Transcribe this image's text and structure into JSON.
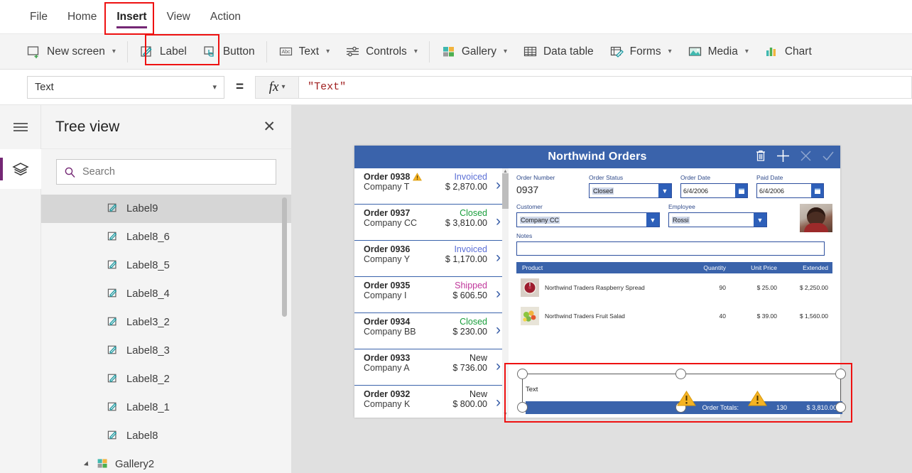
{
  "menu": {
    "tabs": [
      {
        "label": "File",
        "active": false
      },
      {
        "label": "Home",
        "active": false
      },
      {
        "label": "Insert",
        "active": true
      },
      {
        "label": "View",
        "active": false
      },
      {
        "label": "Action",
        "active": false
      }
    ]
  },
  "ribbon": {
    "items": [
      {
        "label": "New screen",
        "icon": "new-screen-icon",
        "caret": true
      },
      {
        "label": "Label",
        "icon": "label-icon",
        "caret": false,
        "highlighted": true
      },
      {
        "label": "Button",
        "icon": "button-icon",
        "caret": false
      },
      {
        "label": "Text",
        "icon": "text-icon",
        "caret": true
      },
      {
        "label": "Controls",
        "icon": "controls-icon",
        "caret": true
      },
      {
        "label": "Gallery",
        "icon": "gallery-icon",
        "caret": true
      },
      {
        "label": "Data table",
        "icon": "data-table-icon",
        "caret": false
      },
      {
        "label": "Forms",
        "icon": "forms-icon",
        "caret": true
      },
      {
        "label": "Media",
        "icon": "media-icon",
        "caret": true
      },
      {
        "label": "Chart",
        "icon": "chart-icon",
        "caret": true
      }
    ]
  },
  "formula_bar": {
    "property": "Text",
    "equals": "=",
    "fx_label": "fx",
    "value": "\"Text\""
  },
  "tree_view": {
    "title": "Tree view",
    "close_label": "✕",
    "search_placeholder": "Search",
    "items": [
      {
        "label": "Label9",
        "selected": true,
        "type": "label"
      },
      {
        "label": "Label8_6",
        "selected": false,
        "type": "label"
      },
      {
        "label": "Label8_5",
        "selected": false,
        "type": "label"
      },
      {
        "label": "Label8_4",
        "selected": false,
        "type": "label"
      },
      {
        "label": "Label3_2",
        "selected": false,
        "type": "label"
      },
      {
        "label": "Label8_3",
        "selected": false,
        "type": "label"
      },
      {
        "label": "Label8_2",
        "selected": false,
        "type": "label"
      },
      {
        "label": "Label8_1",
        "selected": false,
        "type": "label"
      },
      {
        "label": "Label8",
        "selected": false,
        "type": "label"
      },
      {
        "label": "Gallery2",
        "selected": false,
        "type": "gallery"
      }
    ]
  },
  "app": {
    "title": "Northwind Orders",
    "header_icons": [
      "trash-icon",
      "plus-icon",
      "close-icon",
      "check-icon"
    ],
    "orders": [
      {
        "id": "Order 0938",
        "company": "Company T",
        "status": "Invoiced",
        "status_color": "#5b6fd6",
        "amount": "$ 2,870.00",
        "warning": true
      },
      {
        "id": "Order 0937",
        "company": "Company CC",
        "status": "Closed",
        "status_color": "#1a9e3c",
        "amount": "$ 3,810.00",
        "warning": false
      },
      {
        "id": "Order 0936",
        "company": "Company Y",
        "status": "Invoiced",
        "status_color": "#5b6fd6",
        "amount": "$ 1,170.00",
        "warning": false
      },
      {
        "id": "Order 0935",
        "company": "Company I",
        "status": "Shipped",
        "status_color": "#c0379b",
        "amount": "$ 606.50",
        "warning": false
      },
      {
        "id": "Order 0934",
        "company": "Company BB",
        "status": "Closed",
        "status_color": "#1a9e3c",
        "amount": "$ 230.00",
        "warning": false
      },
      {
        "id": "Order 0933",
        "company": "Company A",
        "status": "New",
        "status_color": "#2b2b2b",
        "amount": "$ 736.00",
        "warning": false
      },
      {
        "id": "Order 0932",
        "company": "Company K",
        "status": "New",
        "status_color": "#2b2b2b",
        "amount": "$ 800.00",
        "warning": false
      }
    ],
    "detail": {
      "order_number_label": "Order Number",
      "order_number_value": "0937",
      "order_status_label": "Order Status",
      "order_status_value": "Closed",
      "order_date_label": "Order Date",
      "order_date_value": "6/4/2006",
      "paid_date_label": "Paid Date",
      "paid_date_value": "6/4/2006",
      "customer_label": "Customer",
      "customer_value": "Company CC",
      "employee_label": "Employee",
      "employee_value": "Rossi",
      "notes_label": "Notes",
      "notes_value": ""
    },
    "product_table": {
      "columns": [
        "Product",
        "Quantity",
        "Unit Price",
        "Extended"
      ],
      "rows": [
        {
          "product": "Northwind Traders Raspberry Spread",
          "quantity": "90",
          "unit_price": "$ 25.00",
          "extended": "$ 2,250.00"
        },
        {
          "product": "Northwind Traders Fruit Salad",
          "quantity": "40",
          "unit_price": "$ 39.00",
          "extended": "$ 1,560.00"
        }
      ]
    },
    "totals": {
      "label": "Order Totals:",
      "quantity": "130",
      "amount": "$ 3,810.00"
    },
    "selected_control": {
      "text": "Text"
    }
  },
  "colors": {
    "accent_purple": "#742774",
    "app_blue": "#3a63ab",
    "highlight_red": "#ee1111",
    "canvas_bg": "#e0e0e0"
  }
}
